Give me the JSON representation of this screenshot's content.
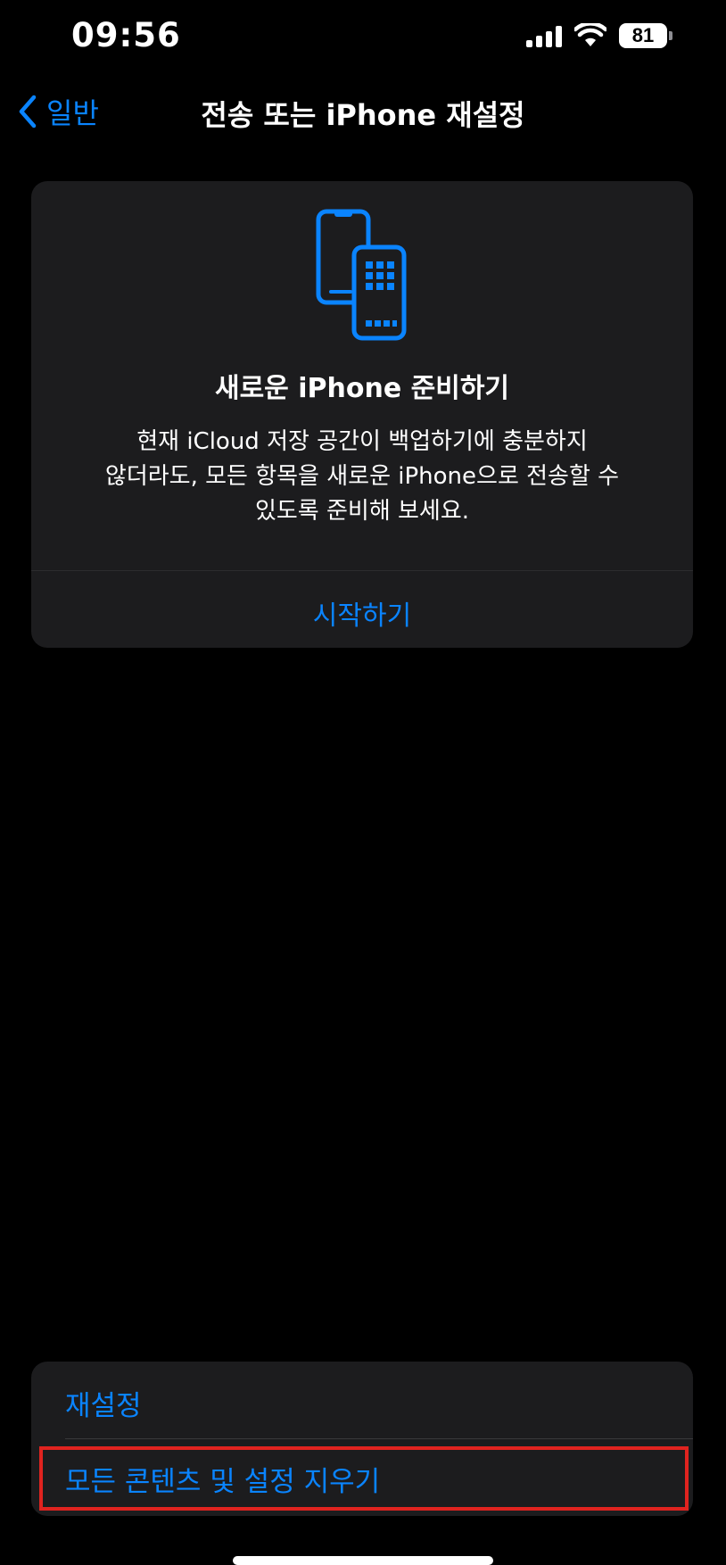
{
  "status_bar": {
    "time": "09:56",
    "battery": "81",
    "icons": [
      "cellular-signal-icon",
      "wifi-icon",
      "battery-icon"
    ]
  },
  "nav": {
    "back_label": "일반",
    "title": "전송 또는 iPhone 재설정"
  },
  "prepare_card": {
    "icon": "transfer-phones-icon",
    "title": "새로운 iPhone 준비하기",
    "description": "현재 iCloud 저장 공간이 백업하기에 충분하지\n않더라도, 모든 항목을 새로운 iPhone으로 전송할 수\n있도록 준비해 보세요.",
    "action_label": "시작하기"
  },
  "reset_group": {
    "items": [
      {
        "label": "재설정"
      },
      {
        "label": "모든 콘텐츠 및 설정 지우기",
        "highlighted": true
      }
    ]
  },
  "colors": {
    "accent": "#0a84ff",
    "background": "#000000",
    "card": "#1c1c1e",
    "highlight": "#e0231f"
  }
}
